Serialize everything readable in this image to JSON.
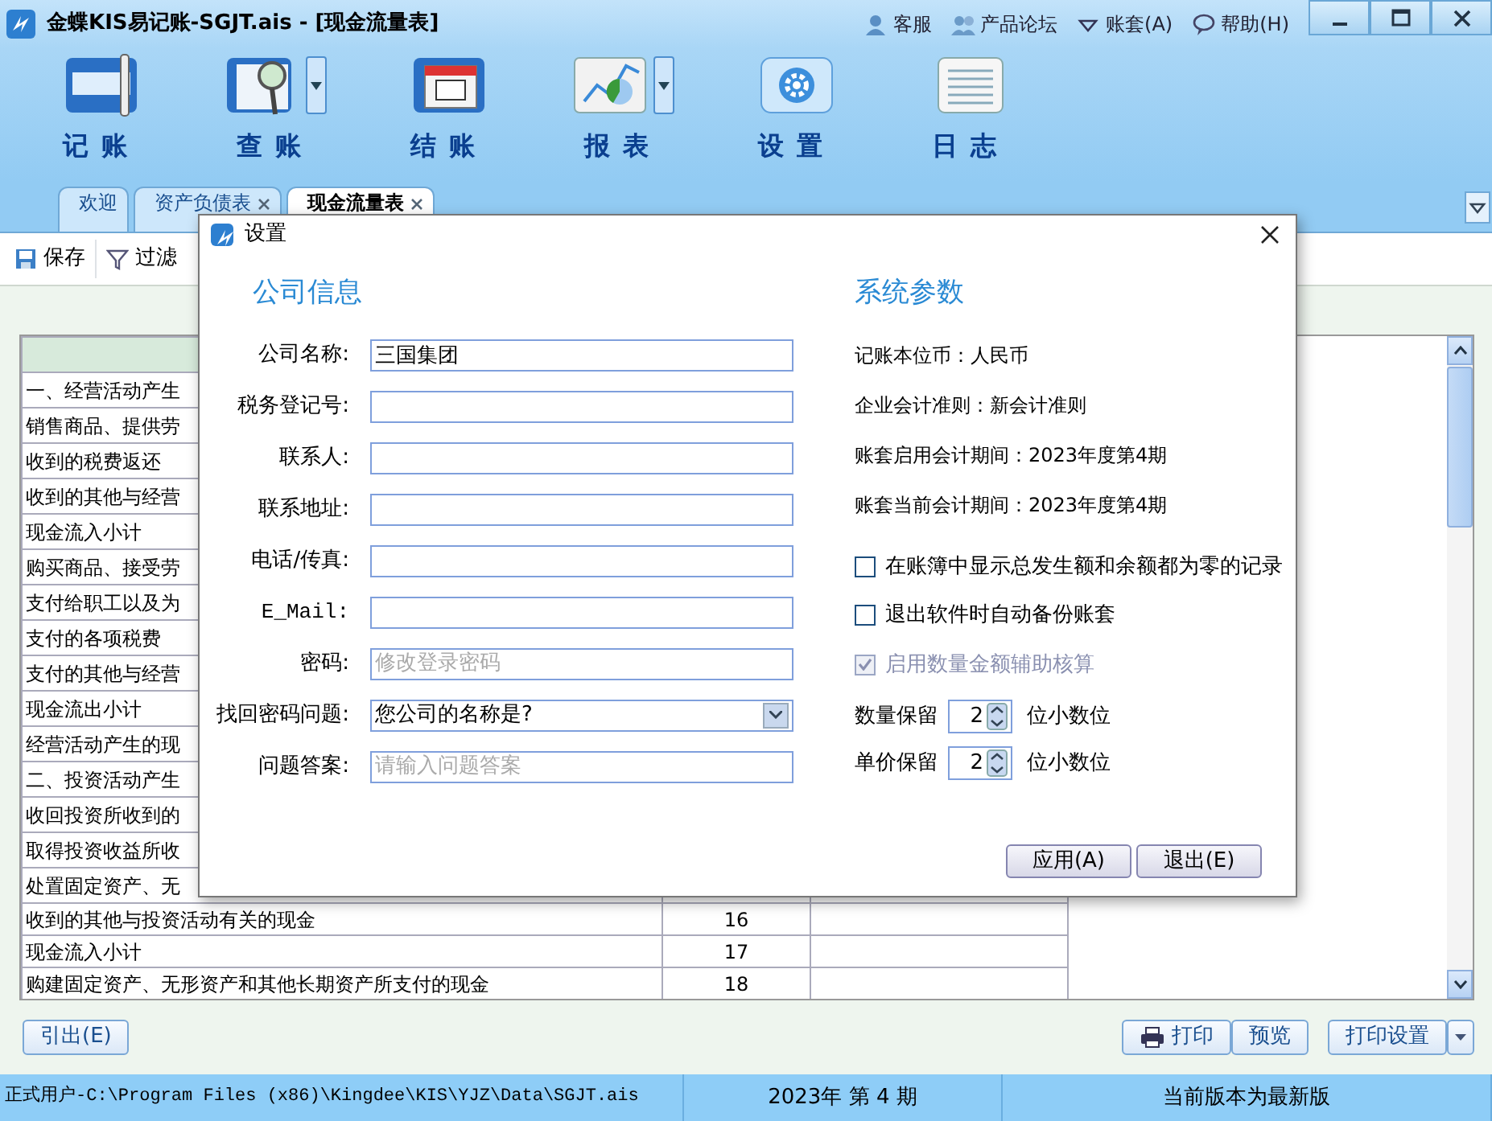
{
  "window": {
    "title": "金蝶KIS易记账-SGJT.ais - [现金流量表]",
    "links": [
      {
        "label": "客服",
        "kind": "person"
      },
      {
        "label": "产品论坛",
        "kind": "people"
      },
      {
        "label": "账套(A)",
        "kind": "caret"
      },
      {
        "label": "帮助(H)",
        "kind": "help"
      }
    ]
  },
  "toolbar": [
    {
      "label": "记账",
      "kind": "notebook",
      "dropdown": false
    },
    {
      "label": "查账",
      "kind": "magnifier",
      "dropdown": true
    },
    {
      "label": "结账",
      "kind": "calendar",
      "dropdown": false
    },
    {
      "label": "报表",
      "kind": "chart",
      "dropdown": true
    },
    {
      "label": "设置",
      "kind": "gear",
      "dropdown": false
    },
    {
      "label": "日志",
      "kind": "list",
      "dropdown": false
    }
  ],
  "tabs": [
    {
      "label": "欢迎",
      "selected": false,
      "closable": false
    },
    {
      "label": "资产负债表",
      "selected": false,
      "closable": true
    },
    {
      "label": "现金流量表",
      "selected": true,
      "closable": true
    }
  ],
  "actions": [
    {
      "label": "保存",
      "kind": "save"
    },
    {
      "label": "过滤",
      "kind": "filter"
    }
  ],
  "table": {
    "rows": [
      {
        "item": "一、经营活动产生",
        "line": ""
      },
      {
        "item": "销售商品、提供劳",
        "line": ""
      },
      {
        "item": "收到的税费返还",
        "line": ""
      },
      {
        "item": "收到的其他与经营",
        "line": ""
      },
      {
        "item": "现金流入小计",
        "line": ""
      },
      {
        "item": "购买商品、接受劳",
        "line": ""
      },
      {
        "item": "支付给职工以及为",
        "line": ""
      },
      {
        "item": "支付的各项税费",
        "line": ""
      },
      {
        "item": "支付的其他与经营",
        "line": ""
      },
      {
        "item": "现金流出小计",
        "line": ""
      },
      {
        "item": "经营活动产生的现",
        "line": ""
      },
      {
        "item": "二、投资活动产生",
        "line": ""
      },
      {
        "item": "收回投资所收到的",
        "line": ""
      },
      {
        "item": "取得投资收益所收",
        "line": ""
      },
      {
        "item": "处置固定资产、无",
        "line": ""
      },
      {
        "item": "收到的其他与投资活动有关的现金",
        "line": "16"
      },
      {
        "item": "现金流入小计",
        "line": "17"
      },
      {
        "item": "购建固定资产、无形资产和其他长期资产所支付的现金",
        "line": "18"
      }
    ]
  },
  "bottom_left": [
    {
      "label": "引出(E)",
      "kind": "plain"
    }
  ],
  "bottom_right": [
    {
      "label": "打印",
      "kind": "print"
    },
    {
      "label": "预览",
      "kind": "plain"
    },
    {
      "label": "打印设置",
      "kind": "dropdown"
    }
  ],
  "status_bar": [
    "正式用户-C:\\Program Files (x86)\\Kingdee\\KIS\\YJZ\\Data\\SGJT.ais",
    "2023年 第 4 期",
    "当前版本为最新版"
  ],
  "dialog": {
    "title": "设置",
    "company": {
      "heading": "公司信息",
      "fields": [
        {
          "label": "公司名称:",
          "kind": "text",
          "value": "三国集团"
        },
        {
          "label": "税务登记号:",
          "kind": "text"
        },
        {
          "label": "联系人:",
          "kind": "text"
        },
        {
          "label": "联系地址:",
          "kind": "text"
        },
        {
          "label": "电话/传真:",
          "kind": "text"
        },
        {
          "label": "E_Mail:",
          "kind": "text"
        },
        {
          "label": "密码:",
          "kind": "text",
          "placeholder": "修改登录密码"
        },
        {
          "label": "找回密码问题:",
          "kind": "select",
          "value": "您公司的名称是?"
        },
        {
          "label": "问题答案:",
          "kind": "text",
          "placeholder": "请输入问题答案"
        }
      ]
    },
    "system": {
      "heading": "系统参数",
      "info": [
        "记账本位币：人民币",
        "企业会计准则：新会计准则",
        "账套启用会计期间：2023年度第4期",
        "账套当前会计期间：2023年度第4期"
      ],
      "checkboxes": [
        {
          "label": "在账簿中显示总发生额和余额都为零的记录",
          "checked": false,
          "disabled": false
        },
        {
          "label": "退出软件时自动备份账套",
          "checked": false,
          "disabled": false
        },
        {
          "label": "启用数量金额辅助核算",
          "checked": true,
          "disabled": true
        }
      ],
      "spinners": [
        {
          "label": "数量保留",
          "value": "2",
          "unit": "位小数位"
        },
        {
          "label": "单价保留",
          "value": "2",
          "unit": "位小数位"
        }
      ]
    },
    "buttons": [
      "应用(A)",
      "退出(E)"
    ]
  }
}
